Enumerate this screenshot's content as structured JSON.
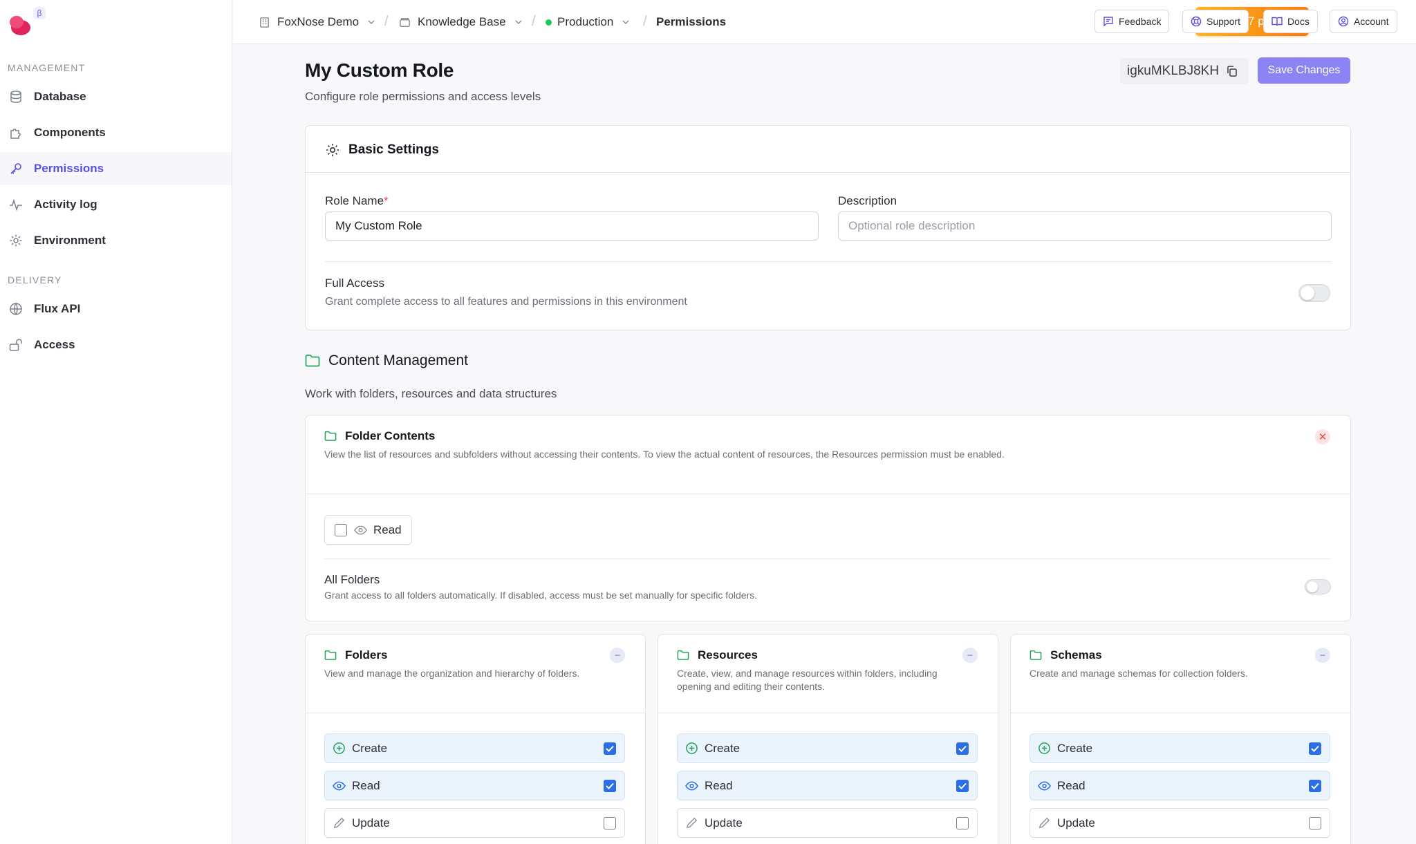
{
  "brand": {
    "beta": "β"
  },
  "sidebar": {
    "management_label": "MANAGEMENT",
    "delivery_label": "DELIVERY",
    "items": [
      {
        "label": "Database",
        "icon": "database-icon"
      },
      {
        "label": "Components",
        "icon": "puzzle-icon"
      },
      {
        "label": "Permissions",
        "icon": "key-icon",
        "active": true
      },
      {
        "label": "Activity log",
        "icon": "activity-icon"
      },
      {
        "label": "Environment",
        "icon": "gear-icon"
      },
      {
        "label": "Flux API",
        "icon": "globe-icon"
      },
      {
        "label": "Access",
        "icon": "unlock-icon"
      }
    ]
  },
  "topbar": {
    "breadcrumbs": [
      "FoxNose Demo",
      "Knowledge Base",
      "Production",
      "Permissions"
    ],
    "powers": "99.87 powers",
    "buttons": {
      "feedback": "Feedback",
      "support": "Support",
      "docs": "Docs",
      "account": "Account"
    }
  },
  "page": {
    "title": "My Custom Role",
    "subtitle": "Configure role permissions and access levels",
    "role_id": "igkuMKLBJ8KH",
    "save_label": "Save Changes"
  },
  "basic": {
    "title": "Basic Settings",
    "role_name_label": "Role Name",
    "required_mark": "*",
    "role_name_value": "My Custom Role",
    "description_label": "Description",
    "description_placeholder": "Optional role description",
    "full_access_title": "Full Access",
    "full_access_desc": "Grant complete access to all features and permissions in this environment",
    "full_access_on": false
  },
  "content_mgmt": {
    "title": "Content Management",
    "subtitle": "Work with folders, resources and data structures",
    "folder_contents": {
      "title": "Folder Contents",
      "desc": "View the list of resources and subfolders without accessing their contents. To view the actual content of resources, the Resources permission must be enabled.",
      "read_label": "Read",
      "read_checked": false,
      "all_folders_title": "All Folders",
      "all_folders_desc": "Grant access to all folders automatically. If disabled, access must be set manually for specific folders.",
      "all_folders_on": false
    },
    "cards": [
      {
        "title": "Folders",
        "desc": "View and manage the organization and hierarchy of folders.",
        "perms": [
          {
            "label": "Create",
            "checked": true
          },
          {
            "label": "Read",
            "checked": true
          },
          {
            "label": "Update",
            "checked": false
          }
        ]
      },
      {
        "title": "Resources",
        "desc": "Create, view, and manage resources within folders, including opening and editing their contents.",
        "perms": [
          {
            "label": "Create",
            "checked": true
          },
          {
            "label": "Read",
            "checked": true
          },
          {
            "label": "Update",
            "checked": false
          }
        ]
      },
      {
        "title": "Schemas",
        "desc": "Create and manage schemas for collection folders.",
        "perms": [
          {
            "label": "Create",
            "checked": true
          },
          {
            "label": "Read",
            "checked": true
          },
          {
            "label": "Update",
            "checked": false
          }
        ]
      }
    ]
  },
  "colors": {
    "accent": "#5b4fe0",
    "save": "#8c83f5",
    "check": "#2b6ee6",
    "folder": "#22a35a",
    "powers_from": "#fbb51f",
    "powers_to": "#f97a12"
  }
}
